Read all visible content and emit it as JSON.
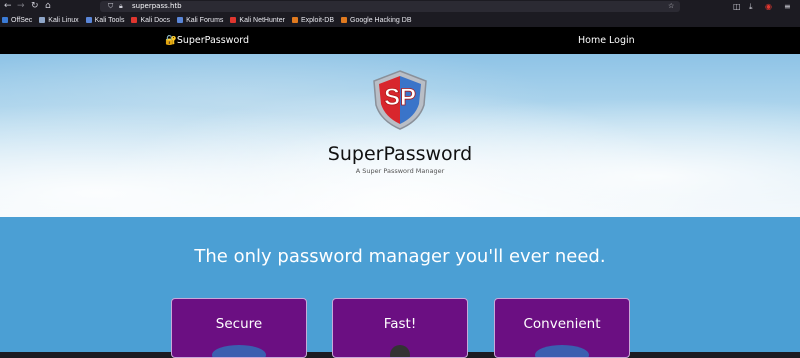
{
  "browser": {
    "back": "←",
    "forward": "→",
    "reload": "↻",
    "home": "⌂",
    "url": "superpass.htb",
    "bookmarks": [
      {
        "label": "OffSec",
        "color": "#3b7bd6"
      },
      {
        "label": "Kali Linux",
        "color": "#8fa6c8"
      },
      {
        "label": "Kali Tools",
        "color": "#5a86d8"
      },
      {
        "label": "Kali Docs",
        "color": "#e0362f"
      },
      {
        "label": "Kali Forums",
        "color": "#5a86d8"
      },
      {
        "label": "Kali NetHunter",
        "color": "#e0362f"
      },
      {
        "label": "Exploit-DB",
        "color": "#e07a1f"
      },
      {
        "label": "Google Hacking DB",
        "color": "#e07a1f"
      }
    ]
  },
  "nav": {
    "brand": "🔐SuperPassword",
    "links": [
      "Home",
      "Login"
    ]
  },
  "hero": {
    "logo_text": "SP",
    "title": "SuperPassword",
    "subtitle": "A Super Password Manager"
  },
  "features": {
    "tagline": "The only password manager you'll ever need.",
    "cards": [
      {
        "title": "Secure"
      },
      {
        "title": "Fast!"
      },
      {
        "title": "Convenient"
      }
    ]
  },
  "colors": {
    "nav_bg": "#000000",
    "section_bg": "#4b9fd4",
    "card_bg": "#6b0f82"
  }
}
